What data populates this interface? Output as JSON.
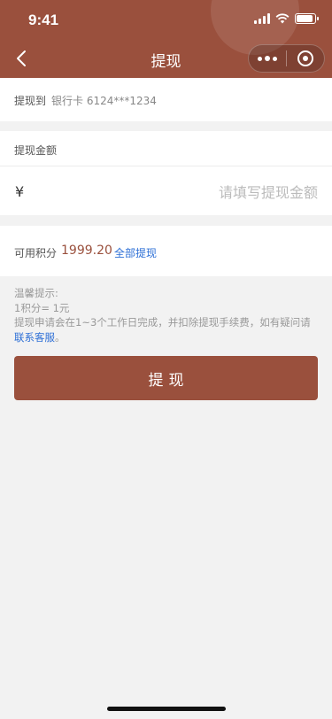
{
  "status_bar": {
    "time": "9:41"
  },
  "nav": {
    "title": "提现"
  },
  "withdraw_to": {
    "label": "提现到",
    "value": "银行卡 6124***1234"
  },
  "amount": {
    "label": "提现金额",
    "currency": "¥",
    "placeholder": "请填写提现金额"
  },
  "points": {
    "label": "可用积分",
    "value": "1999.20",
    "withdraw_all": "全部提现"
  },
  "tips": {
    "title": "温馨提示:",
    "line1": "1积分= 1元",
    "line2": "提现申请会在1~3个工作日完成，并扣除提现手续费，如有疑问请",
    "link": "联系客服",
    "end": "。"
  },
  "submit": {
    "label": "提现"
  },
  "colors": {
    "brand": "#9a503d",
    "link": "#2d6fd6",
    "background": "#f2f2f2"
  }
}
